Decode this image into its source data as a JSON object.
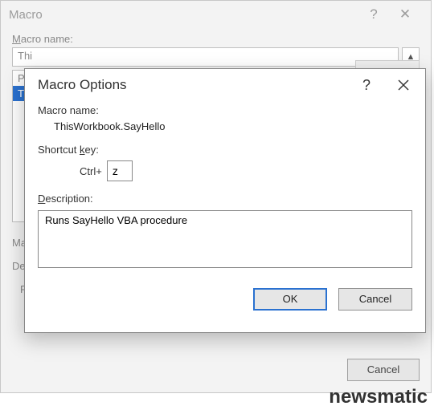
{
  "parent": {
    "title": "Macro",
    "help": "?",
    "close": "✕",
    "macro_name_label_pre": "M",
    "macro_name_label_post": "acro name:",
    "name_field_value": "Thi",
    "list_items": [
      "PE",
      "Thi"
    ],
    "selected_index": 1,
    "lower_labels": {
      "mac": "Ma",
      "des": "Des",
      "r": "R"
    },
    "cancel_label": "Cancel"
  },
  "modal": {
    "title": "Macro Options",
    "help": "?",
    "macro_name_label": "Macro name:",
    "macro_name_value": "ThisWorkbook.SayHello",
    "shortcut_label_pre": "Shortcut ",
    "shortcut_label_u": "k",
    "shortcut_label_post": "ey:",
    "ctrl_text": "Ctrl+",
    "shortcut_value": "z",
    "desc_label_u": "D",
    "desc_label_post": "escription:",
    "description_value": "Runs SayHello VBA procedure",
    "ok_label": "OK",
    "cancel_label": "Cancel"
  },
  "watermark": "newsmatic"
}
